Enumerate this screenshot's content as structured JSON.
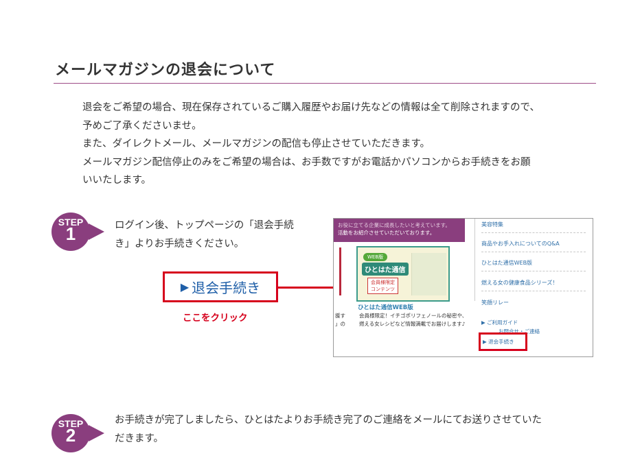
{
  "section": {
    "title": "メールマガジンの退会について"
  },
  "intro": {
    "lines": [
      "退会をご希望の場合、現在保存されているご購入履歴やお届け先などの情報は全て削除されますので、",
      "予めご了承くださいませ。",
      "また、ダイレクトメール、メールマガジンの配信も停止させていただきます。",
      "メールマガジン配信停止のみをご希望の場合は、お手数ですがお電話かパソコンからお手続きをお願",
      "いいたします。"
    ]
  },
  "step1": {
    "badge_word": "STEP",
    "badge_num": "1",
    "lines": [
      "ログイン後、トップページの「退会手続",
      "き」よりお手続きください。"
    ],
    "cta_arrow": "▶",
    "cta_label": "退会手続き",
    "click_hint": "ここをクリック"
  },
  "screenshot": {
    "banner_line1": "お役に立てる企業に成長したいと考えています。",
    "banner_line2": "活動をお紹介させていただいております。",
    "promo_tag": "WEB版",
    "promo_name": "ひとはた通信",
    "promo_members": "会員様限定",
    "promo_sub": "コンテンツ",
    "item_title": "ひとはた通信WEB版",
    "left_frag1": "援す",
    "left_frag2": "」の",
    "item_desc": "会員様限定！イチゴポリフェノールの秘密や、燃える女レシピなど情報満載でお届けします♪",
    "side_items": [
      "美容特集",
      "商品やお手入れについてのQ&A",
      "ひとはた通信WEB版",
      "燃える女の健康食品シリーズ！",
      "笑顔リレー"
    ],
    "side_link1": "▶ ご利用ガイド",
    "side_link2": "お問合せ・ご連絡",
    "side_link3": "▶ 退会手続き"
  },
  "step2": {
    "badge_word": "STEP",
    "badge_num": "2",
    "lines": [
      "お手続きが完了しましたら、ひとはたよりお手続き完了のご連絡をメールにてお送りさせていた",
      "だきます。"
    ]
  },
  "colors": {
    "accent": "#8a3e7e",
    "highlight": "#d6001c",
    "link": "#1f5fa8"
  }
}
